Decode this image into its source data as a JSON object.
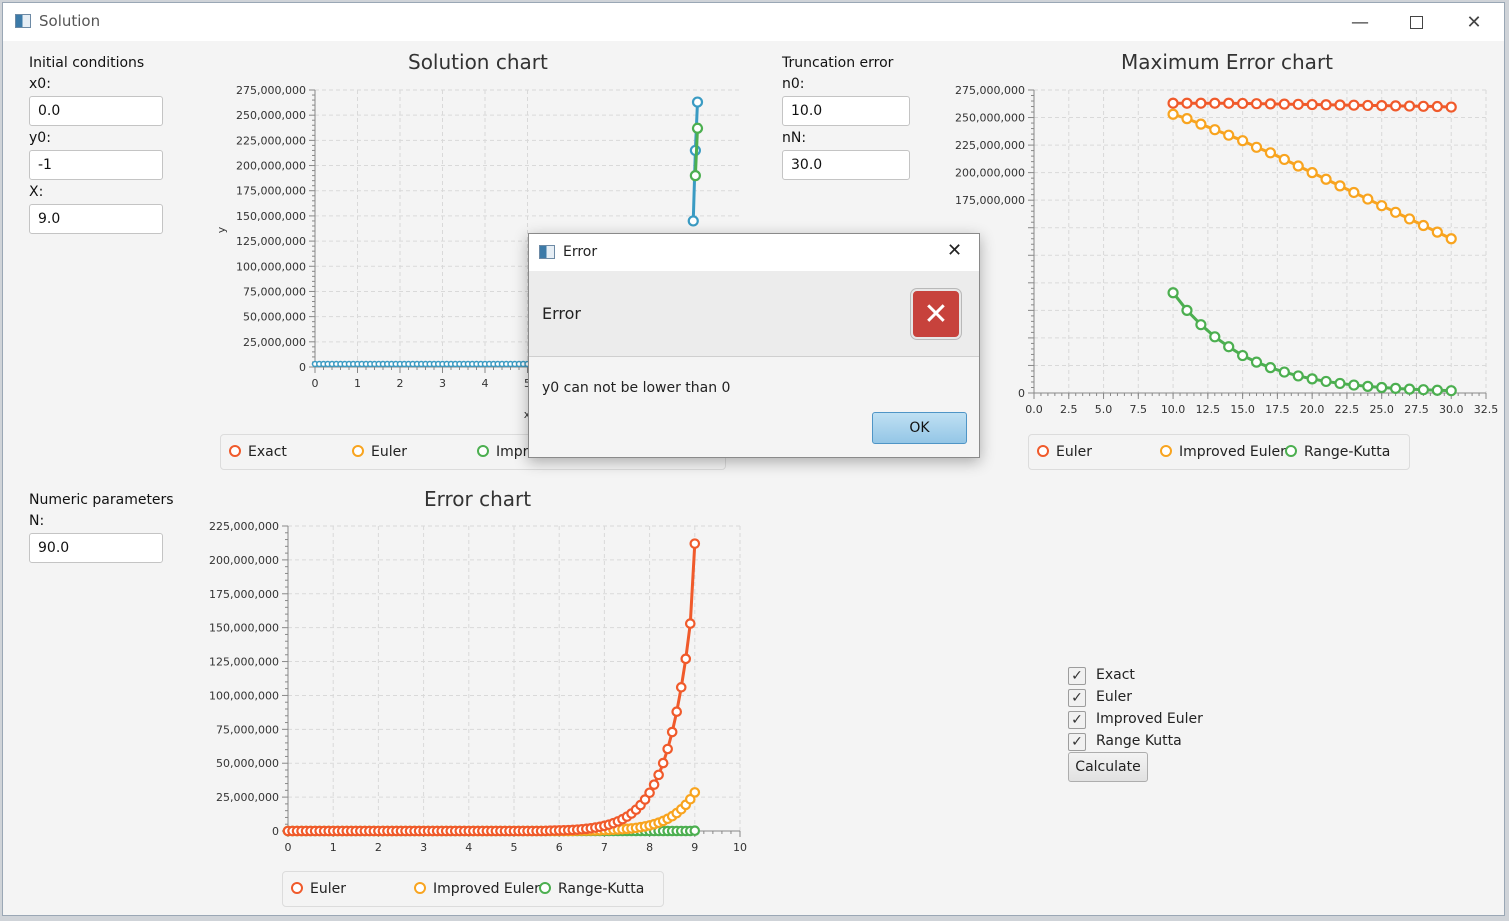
{
  "window": {
    "title": "Solution",
    "minimize_icon": "minimize-icon",
    "maximize_icon": "maximize-icon",
    "close_icon": "close-icon"
  },
  "initial_conditions": {
    "header": "Initial conditions",
    "x0_label": "x0:",
    "x0_value": "0.0",
    "y0_label": "y0:",
    "y0_value": "-1",
    "X_label": "X:",
    "X_value": "9.0"
  },
  "numeric_parameters": {
    "header": "Numeric parameters",
    "N_label": "N:",
    "N_value": "90.0"
  },
  "truncation_error": {
    "header": "Truncation error",
    "n0_label": "n0:",
    "n0_value": "10.0",
    "nN_label": "nN:",
    "nN_value": "30.0"
  },
  "colors": {
    "euler": "#f05a2b",
    "improved_euler": "#f8a41f",
    "range_kutta": "#4caf50",
    "exact": "#3a9bc3"
  },
  "chart_data": [
    {
      "type": "line",
      "title": "Solution chart",
      "xlabel": "x",
      "ylabel": "y",
      "xlim": [
        0,
        10
      ],
      "ylim": [
        0,
        275000000
      ],
      "x_ticks": [
        "0",
        "1",
        "2",
        "3",
        "4",
        "5"
      ],
      "y_ticks": [
        "0",
        "25,000,000",
        "50,000,000",
        "75,000,000",
        "100,000,000",
        "125,000,000",
        "150,000,000",
        "175,000,000",
        "200,000,000",
        "225,000,000",
        "250,000,000",
        "275,000,000"
      ],
      "legend": [
        "Exact",
        "Euler",
        "Improved Euler",
        "Range-Kutta"
      ],
      "legend_visible": [
        "Exact",
        "Euler",
        "Impr"
      ],
      "series": [
        {
          "name": "Exact",
          "x": [
            8.9,
            8.95,
            9.0
          ],
          "y": [
            145000000,
            215000000,
            263000000
          ]
        },
        {
          "name": "Range-Kutta",
          "x": [
            8.95,
            9.0
          ],
          "y": [
            190000000,
            237000000
          ]
        }
      ]
    },
    {
      "type": "line",
      "title": "Maximum Error chart",
      "xlim": [
        0,
        32.5
      ],
      "ylim": [
        0,
        275000000
      ],
      "x_ticks": [
        "0.0",
        "2.5",
        "5.0",
        "7.5",
        "10.0",
        "12.5",
        "15.0",
        "17.5",
        "20.0",
        "22.5",
        "25.0",
        "27.5",
        "30.0",
        "32.5"
      ],
      "y_ticks": [
        "0",
        "25,000,000",
        "50,000,000",
        "75,000,000",
        "100,000,000",
        "125,000,000",
        "150,000,000",
        "175,000,000",
        "200,000,000",
        "225,000,000",
        "250,000,000",
        "275,000,000"
      ],
      "y_ticks_visible": [
        "0",
        "175,000,000",
        "200,000,000",
        "225,000,000",
        "250,000,000",
        "275,000,000"
      ],
      "legend": [
        "Euler",
        "Improved Euler",
        "Range-Kutta"
      ],
      "x": [
        10,
        11,
        12,
        13,
        14,
        15,
        16,
        17,
        18,
        19,
        20,
        21,
        22,
        23,
        24,
        25,
        26,
        27,
        28,
        29,
        30
      ],
      "series": [
        {
          "name": "Euler",
          "values": [
            263000000,
            263000000,
            263000000,
            263000000,
            263000000,
            262800000,
            262600000,
            262400000,
            262200000,
            262000000,
            261800000,
            261600000,
            261400000,
            261200000,
            261000000,
            260800000,
            260600000,
            260400000,
            260200000,
            260000000,
            259500000
          ]
        },
        {
          "name": "Improved Euler",
          "values": [
            253000000,
            249000000,
            244000000,
            239000000,
            234000000,
            229000000,
            223000000,
            218000000,
            212000000,
            206000000,
            200000000,
            194000000,
            188000000,
            182000000,
            176000000,
            170000000,
            164000000,
            158000000,
            152000000,
            146000000,
            140000000
          ]
        },
        {
          "name": "Range-Kutta",
          "values": [
            91000000,
            75000000,
            62000000,
            51000000,
            42000000,
            34000000,
            28000000,
            23000000,
            19000000,
            15500000,
            12800000,
            10500000,
            8700000,
            7200000,
            6000000,
            5000000,
            4200000,
            3500000,
            3000000,
            2500000,
            2100000
          ]
        }
      ]
    },
    {
      "type": "line",
      "title": "Error chart",
      "xlim": [
        0,
        10
      ],
      "ylim": [
        0,
        225000000
      ],
      "x_ticks": [
        "0",
        "1",
        "2",
        "3",
        "4",
        "5",
        "6",
        "7",
        "8",
        "9",
        "10"
      ],
      "y_ticks": [
        "0",
        "25,000,000",
        "50,000,000",
        "75,000,000",
        "100,000,000",
        "125,000,000",
        "150,000,000",
        "175,000,000",
        "200,000,000",
        "225,000,000"
      ],
      "legend": [
        "Euler",
        "Improved Euler",
        "Range-Kutta"
      ],
      "x": [
        0,
        0.1,
        0.2,
        0.3,
        0.4,
        0.5,
        0.6,
        0.7,
        0.8,
        0.9,
        1.0,
        1.1,
        1.2,
        1.3,
        1.4,
        1.5,
        1.6,
        1.7,
        1.8,
        1.9,
        2.0,
        2.1,
        2.2,
        2.3,
        2.4,
        2.5,
        2.6,
        2.7,
        2.8,
        2.9,
        3.0,
        3.1,
        3.2,
        3.3,
        3.4,
        3.5,
        3.6,
        3.7,
        3.8,
        3.9,
        4.0,
        4.1,
        4.2,
        4.3,
        4.4,
        4.5,
        4.6,
        4.7,
        4.8,
        4.9,
        5.0,
        5.1,
        5.2,
        5.3,
        5.4,
        5.5,
        5.6,
        5.7,
        5.8,
        5.9,
        6.0,
        6.1,
        6.2,
        6.3,
        6.4,
        6.5,
        6.6,
        6.7,
        6.8,
        6.9,
        7.0,
        7.1,
        7.2,
        7.3,
        7.4,
        7.5,
        7.6,
        7.7,
        7.8,
        7.9,
        8.0,
        8.1,
        8.2,
        8.3,
        8.4,
        8.5,
        8.6,
        8.7,
        8.8,
        8.9,
        9.0
      ],
      "series": [
        {
          "name": "Euler",
          "values": [
            0,
            0,
            0,
            0,
            0,
            0,
            0,
            0,
            0,
            0,
            0,
            0,
            0,
            0,
            0,
            0,
            0,
            0,
            0,
            0,
            0,
            0,
            0,
            0,
            0,
            0,
            0,
            0,
            0,
            0,
            0,
            0,
            0,
            0,
            0,
            0,
            0,
            0,
            0,
            0,
            0,
            0,
            0,
            0,
            0,
            0,
            0,
            0,
            0,
            0,
            0,
            0,
            0,
            0,
            0,
            0,
            0,
            100000,
            200000,
            300000,
            400000,
            500000,
            600000,
            800000,
            1000000,
            1300000,
            1600000,
            2000000,
            2500000,
            3100000,
            3800000,
            4700000,
            5800000,
            7100000,
            8700000,
            10600000,
            12900000,
            15700000,
            19100000,
            23200000,
            28200000,
            34200000,
            41400000,
            50100000,
            60500000,
            73000000,
            88000000,
            106000000,
            127000000,
            153000000,
            212000000
          ]
        },
        {
          "name": "Improved Euler",
          "values": [
            0,
            0,
            0,
            0,
            0,
            0,
            0,
            0,
            0,
            0,
            0,
            0,
            0,
            0,
            0,
            0,
            0,
            0,
            0,
            0,
            0,
            0,
            0,
            0,
            0,
            0,
            0,
            0,
            0,
            0,
            0,
            0,
            0,
            0,
            0,
            0,
            0,
            0,
            0,
            0,
            0,
            0,
            0,
            0,
            0,
            0,
            0,
            0,
            0,
            0,
            0,
            0,
            0,
            0,
            0,
            0,
            0,
            0,
            0,
            0,
            0,
            0,
            0,
            100000,
            200000,
            200000,
            300000,
            300000,
            400000,
            500000,
            600000,
            700000,
            900000,
            1100000,
            1300000,
            1600000,
            1900000,
            2300000,
            2800000,
            3400000,
            4100000,
            5000000,
            6100000,
            7400000,
            9000000,
            10900000,
            13200000,
            16000000,
            19300000,
            23400000,
            28500000
          ]
        },
        {
          "name": "Range-Kutta",
          "values": [
            0,
            0,
            0,
            0,
            0,
            0,
            0,
            0,
            0,
            0,
            0,
            0,
            0,
            0,
            0,
            0,
            0,
            0,
            0,
            0,
            0,
            0,
            0,
            0,
            0,
            0,
            0,
            0,
            0,
            0,
            0,
            0,
            0,
            0,
            0,
            0,
            0,
            0,
            0,
            0,
            0,
            0,
            0,
            0,
            0,
            0,
            0,
            0,
            0,
            0,
            0,
            0,
            0,
            0,
            0,
            0,
            0,
            0,
            0,
            0,
            0,
            0,
            0,
            0,
            0,
            0,
            0,
            0,
            0,
            0,
            0,
            0,
            0,
            0,
            0,
            0,
            0,
            0,
            0,
            0,
            0,
            0,
            0,
            0,
            0,
            0,
            0,
            0,
            0,
            0,
            200000
          ]
        }
      ]
    }
  ],
  "checkboxes": [
    {
      "label": "Exact",
      "checked": true
    },
    {
      "label": "Euler",
      "checked": true
    },
    {
      "label": "Improved Euler",
      "checked": true
    },
    {
      "label": "Range Kutta",
      "checked": true
    }
  ],
  "check_mark": "✓",
  "calculate_label": "Calculate",
  "dialog": {
    "title": "Error",
    "header": "Error",
    "message": "y0 can not be lower than 0",
    "ok_label": "OK",
    "error_icon": "error-icon",
    "close_icon": "close-icon"
  }
}
